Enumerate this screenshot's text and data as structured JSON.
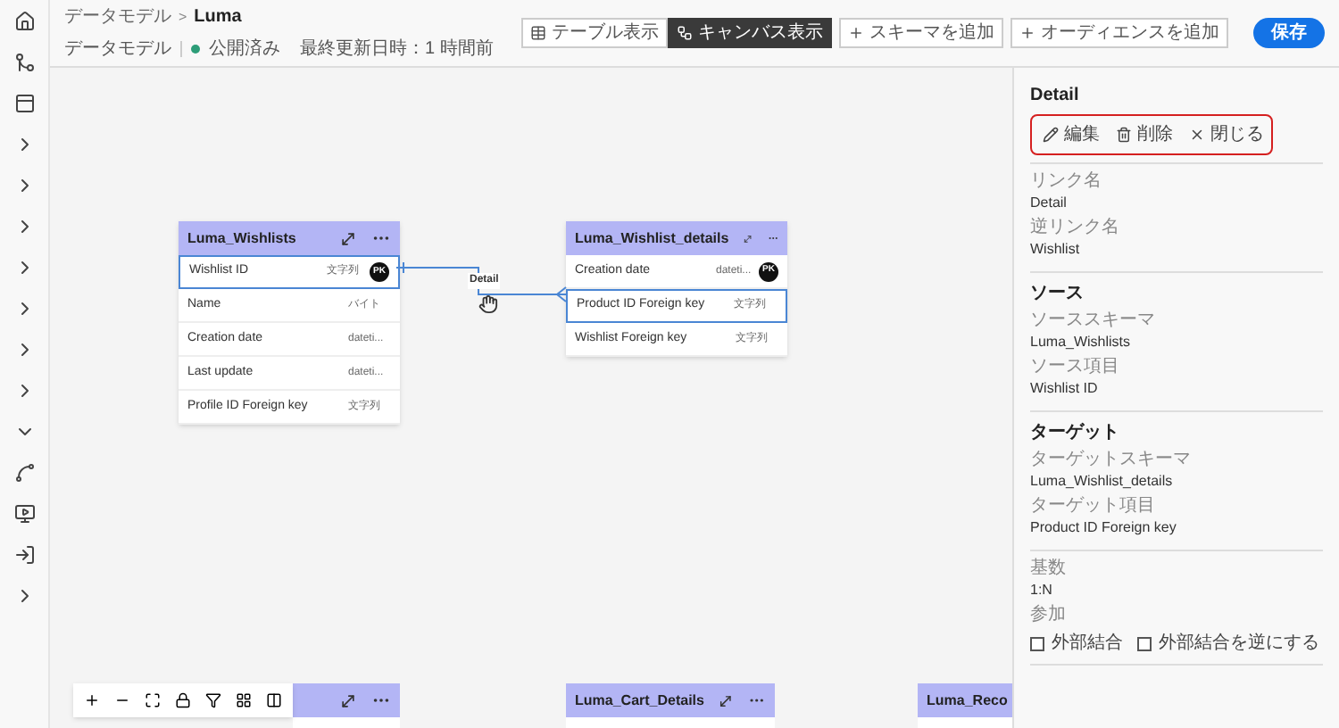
{
  "breadcrumb": {
    "parent": "データモデル",
    "separator": ">",
    "current": "Luma"
  },
  "meta": {
    "type": "データモデル",
    "status": "公開済み",
    "updated": "最終更新日時：1 時間前"
  },
  "view_tabs": [
    {
      "label": "テーブル表示",
      "selected": false
    },
    {
      "label": "キャンバス表示",
      "selected": true
    }
  ],
  "actions": [
    {
      "label": "スキーマを追加"
    },
    {
      "label": "オーディエンスを追加"
    }
  ],
  "save_button": "保存",
  "tables": [
    {
      "title": "Luma_Wishlists",
      "fields": [
        {
          "name": "Wishlist ID",
          "type": "文字列",
          "badge": "PK",
          "selected": true
        },
        {
          "name": "Name",
          "type": "バイト",
          "selected": false
        },
        {
          "name": "Creation date",
          "type": "dateti...",
          "selected": false
        },
        {
          "name": "Last update",
          "type": "dateti...",
          "selected": false
        },
        {
          "name": "Profile ID Foreign key",
          "type": "文字列",
          "selected": false
        }
      ]
    },
    {
      "title": "Luma_Wishlist_details",
      "fields": [
        {
          "name": "Creation date",
          "type": "dateti...",
          "badge": "PK",
          "selected": false
        },
        {
          "name": "Product ID Foreign key",
          "type": "文字列",
          "selected": true
        },
        {
          "name": "Wishlist Foreign key",
          "type": "文字列",
          "selected": false
        }
      ]
    }
  ],
  "link_label": "Detail",
  "bottom_tables": [
    {
      "kind": "covered"
    },
    {
      "kind": "titled",
      "title": "Luma_Cart_Details"
    },
    {
      "kind": "titled",
      "title": "Luma_Reco"
    }
  ],
  "panel": {
    "title": "Detail",
    "actions": [
      {
        "kind": "edit",
        "label": "編集"
      },
      {
        "kind": "delete",
        "label": "削除"
      },
      {
        "kind": "close",
        "label": "閉じる"
      }
    ],
    "sections": [
      {
        "fields": [
          {
            "label": "リンク名",
            "value": "Detail"
          },
          {
            "label": "逆リンク名",
            "value": "Wishlist"
          }
        ]
      },
      {
        "heading": "ソース",
        "fields": [
          {
            "label": "ソーススキーマ",
            "value": "Luma_Wishlists"
          },
          {
            "label": "ソース項目",
            "value": "Wishlist ID"
          }
        ]
      },
      {
        "heading": "ターゲット",
        "fields": [
          {
            "label": "ターゲットスキーマ",
            "value": "Luma_Wishlist_details"
          },
          {
            "label": "ターゲット項目",
            "value": "Product ID Foreign key"
          }
        ]
      },
      {
        "fields": [
          {
            "label": "基数",
            "value": "1:N"
          }
        ],
        "join_label": "参加",
        "options": [
          {
            "label": "外部結合",
            "checked": false
          },
          {
            "label": "外部結合を逆にする",
            "checked": false
          }
        ]
      }
    ]
  }
}
